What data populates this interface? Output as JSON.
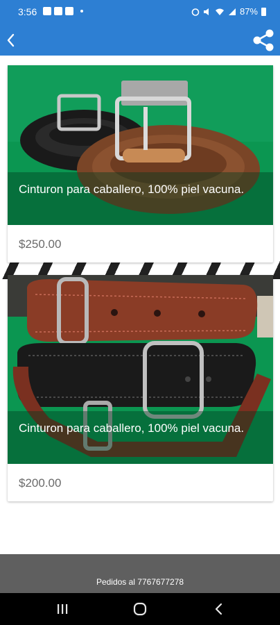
{
  "status_bar": {
    "time": "3:56",
    "battery": "87%"
  },
  "products": [
    {
      "title": "Cinturon para caballero, 100% piel vacuna.",
      "price": "$250.00"
    },
    {
      "title": "Cinturon para caballero, 100% piel vacuna.",
      "price": "$200.00"
    }
  ],
  "footer": {
    "text": "Pedidos al 7767677278"
  },
  "icons": {
    "back": "back-arrow-icon",
    "share": "share-icon",
    "recents": "recents-icon",
    "home": "home-icon",
    "nav_back": "nav-back-icon"
  },
  "colors": {
    "primary": "#2d7fd3",
    "footer": "#5f5f5f",
    "price": "#6a6a6a"
  }
}
